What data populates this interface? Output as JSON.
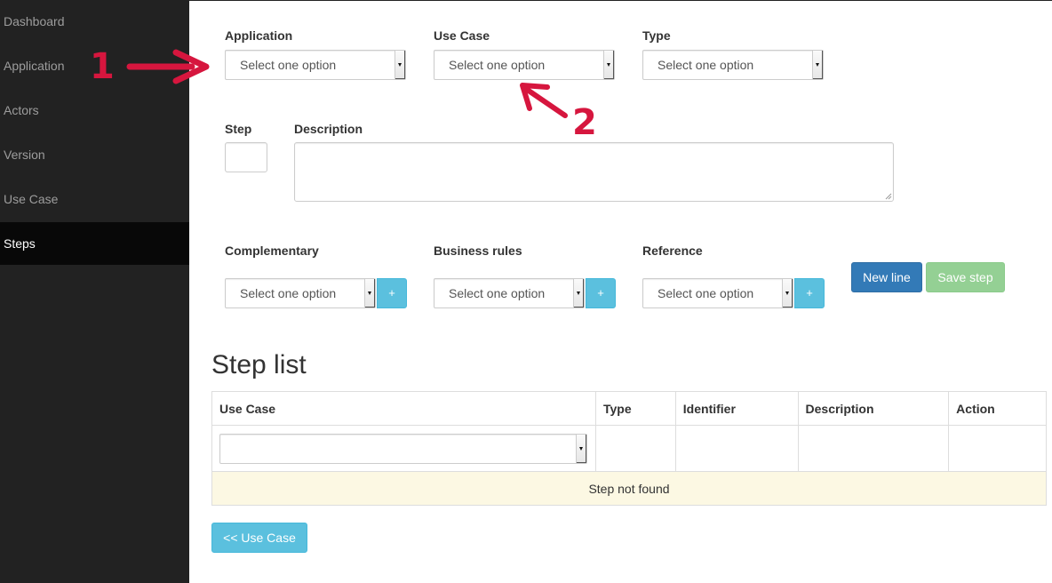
{
  "sidebar": {
    "items": [
      "Dashboard",
      "Application",
      "Actors",
      "Version",
      "Use Case",
      "Steps"
    ],
    "active": "Steps"
  },
  "form": {
    "application_label": "Application",
    "usecase_label": "Use Case",
    "type_label": "Type",
    "step_label": "Step",
    "description_label": "Description",
    "complementary_label": "Complementary",
    "business_rules_label": "Business rules",
    "reference_label": "Reference",
    "select_placeholder": "Select one option",
    "plus": "+",
    "new_line": "New line",
    "save_step": "Save step"
  },
  "step_list": {
    "title": "Step list",
    "columns": [
      "Use Case",
      "Type",
      "Identifier",
      "Description",
      "Action"
    ],
    "empty_message": "Step not found"
  },
  "back_button": "<< Use Case",
  "annotations": [
    "1",
    "2"
  ],
  "colors": {
    "annotation": "#d6163e",
    "sidebar": "#222222",
    "primary": "#337ab7",
    "info": "#5bc0de",
    "success": "#5cb85c"
  }
}
